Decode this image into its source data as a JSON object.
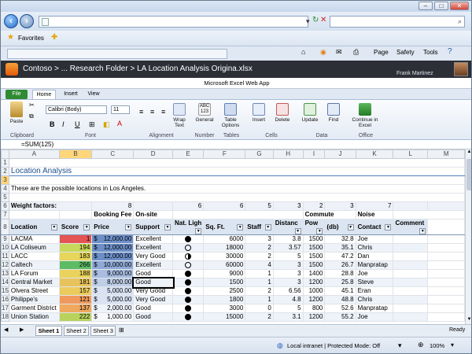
{
  "browser": {
    "address_placeholder": "",
    "search_placeholder": "",
    "favorites_label": "Favorites",
    "commands": [
      "Page",
      "Safety",
      "Tools"
    ],
    "window_buttons": [
      "–",
      "□",
      "✕"
    ]
  },
  "app": {
    "site": "Contoso",
    "breadcrumb": "... Research Folder",
    "file": "LA Location Analysis Origina.xlsx",
    "user": "Frank Martinez",
    "product": "Microsoft Excel Web App"
  },
  "ribbon": {
    "tabs": [
      "File",
      "Home",
      "Insert",
      "View"
    ],
    "active_tab": "Home",
    "paste": "Paste",
    "font_name": "Calibri (Body)",
    "font_size": "11",
    "wrap_text": "Wrap Text",
    "number_format": "General",
    "table_options": "Table Options",
    "insert": "Insert",
    "delete": "Delete",
    "update": "Update",
    "find": "Find",
    "continue_excel": "Continue in Excel",
    "groups": [
      "Clipboard",
      "Font",
      "Alignment",
      "Number",
      "Tables",
      "Cells",
      "Data",
      "Office"
    ]
  },
  "formula_bar": {
    "content": "=SUM(125)"
  },
  "sheet": {
    "columns": [
      "A",
      "B",
      "C",
      "D",
      "E",
      "F",
      "G",
      "H",
      "I",
      "J",
      "K",
      "L",
      "M"
    ],
    "title": "Location Analysis",
    "description": "These are the possible locations in Los Angeles.",
    "weight_label": "Weight factors:",
    "weights": [
      "8",
      "6",
      "6",
      "5",
      "3",
      "2",
      "3",
      "7"
    ],
    "group_headers": {
      "booking": "Booking Fee",
      "onsite": "On-site",
      "commute": "Commute",
      "noise": "Noise"
    },
    "headers": [
      "Location",
      "Score",
      "Price",
      "Support",
      "Nat. Ligh",
      "Sq. Ft.",
      "Staff",
      "Distanc",
      "Pow",
      "(db)",
      "Contact",
      "Comment"
    ],
    "rows": [
      {
        "row": "9",
        "location": "LACMA",
        "score": "1",
        "price": "12,000.00",
        "support": "Excellent",
        "light": "full",
        "sqft": "6000",
        "staff": "3",
        "distance": "3.8",
        "power": "1500",
        "db": "32.8",
        "contact": "Joe"
      },
      {
        "row": "10",
        "location": "LA Coliseum",
        "score": "194",
        "price": "12,000.00",
        "support": "Excellent",
        "light": "empty",
        "sqft": "18000",
        "staff": "2",
        "distance": "3.57",
        "power": "1500",
        "db": "35.1",
        "contact": "Chris"
      },
      {
        "row": "11",
        "location": "LACC",
        "score": "183",
        "price": "12,000.00",
        "support": "Very Good",
        "light": "half",
        "sqft": "30000",
        "staff": "2",
        "distance": "5",
        "power": "1500",
        "db": "47.2",
        "contact": "Dan"
      },
      {
        "row": "12",
        "location": "Caltech",
        "score": "266",
        "price": "10,000.00",
        "support": "Excellent",
        "light": "empty",
        "sqft": "60000",
        "staff": "4",
        "distance": "3",
        "power": "1500",
        "db": "26.7",
        "contact": "Manpratap"
      },
      {
        "row": "13",
        "location": "LA Forum",
        "score": "188",
        "price": "9,000.00",
        "support": "Good",
        "light": "full",
        "sqft": "9000",
        "staff": "1",
        "distance": "3",
        "power": "1400",
        "db": "28.8",
        "contact": "Joe"
      },
      {
        "row": "14",
        "location": "Central Market",
        "score": "181",
        "price": "8,000.00",
        "support": "Good",
        "light": "full",
        "sqft": "1500",
        "staff": "1",
        "distance": "3",
        "power": "1200",
        "db": "25.8",
        "contact": "Steve"
      },
      {
        "row": "15",
        "location": "Olvera Street",
        "score": "157",
        "price": "5,000.00",
        "support": "Very Good",
        "light": "full",
        "sqft": "2500",
        "staff": "2",
        "distance": "6.56",
        "power": "1000",
        "db": "45.1",
        "contact": "Eran"
      },
      {
        "row": "16",
        "location": "Philippe's",
        "score": "121",
        "price": "5,000.00",
        "support": "Very Good",
        "light": "full",
        "sqft": "1800",
        "staff": "1",
        "distance": "4.8",
        "power": "1200",
        "db": "48.8",
        "contact": "Chris"
      },
      {
        "row": "17",
        "location": "Garment District",
        "score": "137",
        "price": "2,000.00",
        "support": "Good",
        "light": "full",
        "sqft": "3000",
        "staff": "0",
        "distance": "5",
        "power": "800",
        "db": "52.6",
        "contact": "Manpratap"
      },
      {
        "row": "18",
        "location": "Union Station",
        "score": "222",
        "price": "1,000.00",
        "support": "Good",
        "light": "full",
        "sqft": "15000",
        "staff": "2",
        "distance": "3.1",
        "power": "1200",
        "db": "55.2",
        "contact": "Joe"
      }
    ],
    "score_colors": [
      "#e45454",
      "#c8d85a",
      "#e6d65a",
      "#5dbb63",
      "#e9d35a",
      "#e8c35c",
      "#eccb5e",
      "#ef9a5c",
      "#f0a85e",
      "#b9d25c"
    ],
    "price_colors": [
      "#6d8fc8",
      "#6d8fc8",
      "#6d8fc8",
      "#8fa9d6",
      "#a8bde0",
      "#bfcfe8",
      "#d9e3f3",
      "#d9e3f3",
      "#eef2fa",
      "#f6f8fc"
    ]
  },
  "sheet_tabs": [
    "Sheet 1",
    "Sheet 2",
    "Sheet 3"
  ],
  "status": {
    "ready": "Ready",
    "zone": "Local intranet | Protected Mode: Off",
    "zoom": "100%"
  }
}
